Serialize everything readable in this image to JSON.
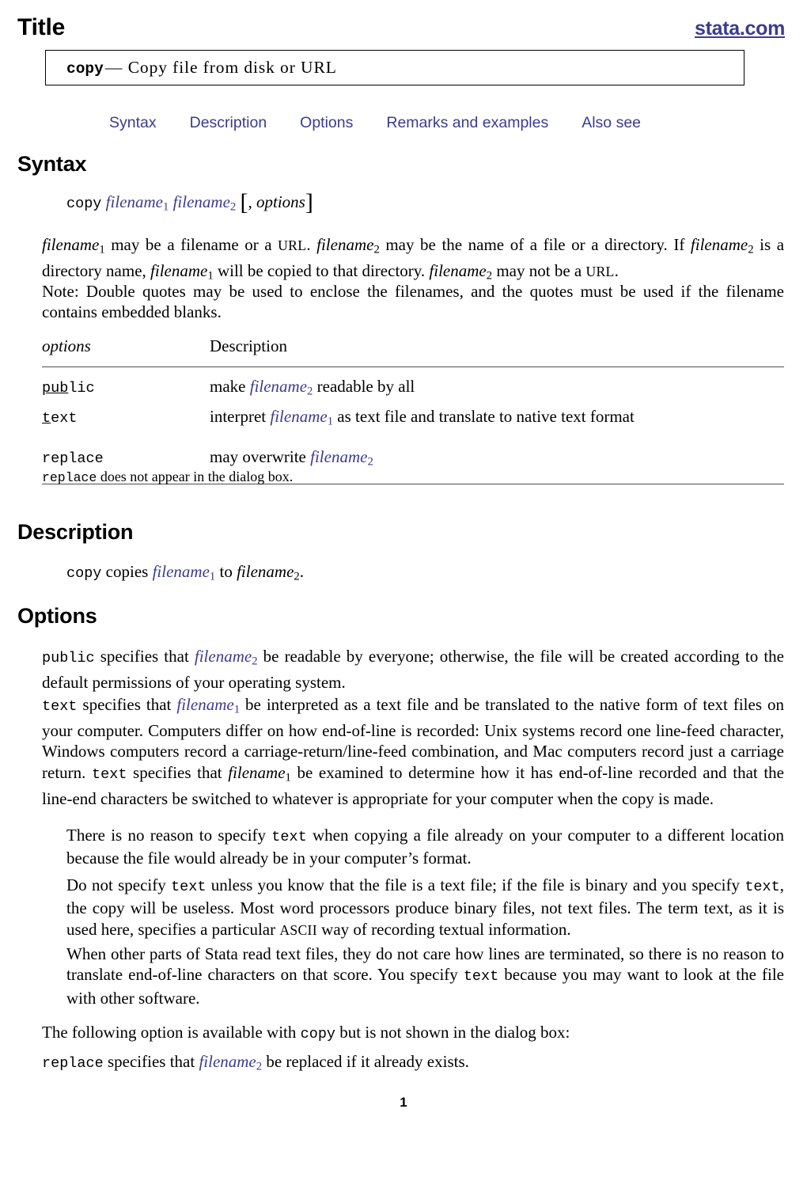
{
  "header": {
    "title": "Title",
    "site": "stata.com"
  },
  "title_box": {
    "command": "copy",
    "dash": "—",
    "description": "Copy file from disk or URL"
  },
  "nav": {
    "links": [
      {
        "label": "Syntax"
      },
      {
        "label": "Description"
      },
      {
        "label": "Options"
      },
      {
        "label": "Remarks and examples"
      },
      {
        "label": "Also see"
      }
    ]
  },
  "sections": {
    "syntax": {
      "heading": "Syntax",
      "command": "copy",
      "arg1": "filename",
      "arg1_sub": "1",
      "arg2": "filename",
      "arg2_sub": "2",
      "bracket_open": "[",
      "comma": ",",
      "options_word": "options",
      "bracket_close": "]",
      "para1_a": "filename",
      "para1_a_sub": "1",
      "para1_b": " may be a filename or a ",
      "para1_url1": "URL",
      "para1_c": ". ",
      "para1_d": "filename",
      "para1_d_sub": "2",
      "para1_e": " may be the name of a file or a directory. If ",
      "para1_f": "filename",
      "para1_f_sub": "2",
      "para1_g": " is a directory name, ",
      "para1_h": "filename",
      "para1_h_sub": "1",
      "para1_i": " will be copied to that directory. ",
      "para1_j": "filename",
      "para1_j_sub": "2",
      "para1_k": " may not be a ",
      "para1_url2": "URL",
      "para1_l": ".",
      "note": "Note: Double quotes may be used to enclose the filenames, and the quotes must be used if the filename contains embedded blanks."
    },
    "options_table": {
      "header_options": "options",
      "header_description": "Description",
      "rows": [
        {
          "option_abbrev": "pub",
          "option_rest": "lic",
          "desc_pre": "make ",
          "desc_link": "filename",
          "desc_link_sub": "2",
          "desc_post": " readable by all"
        },
        {
          "option_abbrev": "t",
          "option_rest": "ext",
          "desc_pre": "interpret ",
          "desc_link": "filename",
          "desc_link_sub": "1",
          "desc_post": " as text file and translate to native text format"
        },
        {
          "option_abbrev": "",
          "option_rest": "replace",
          "desc_pre": "may overwrite ",
          "desc_link": "filename",
          "desc_link_sub": "2",
          "desc_post": ""
        }
      ],
      "note_mono": "replace",
      "note_rest": " does not appear in the dialog box."
    },
    "description": {
      "heading": "Description",
      "cmd": "copy",
      "text_a": " copies ",
      "link1": "filename",
      "link1_sub": "1",
      "text_b": " to ",
      "plain1": "filename",
      "plain1_sub": "2",
      "text_c": "."
    },
    "options": {
      "heading": "Options",
      "public": {
        "cmd": "public",
        "a": " specifies that ",
        "link": "filename",
        "link_sub": "2",
        "b": " be readable by everyone; otherwise, the file will be created according to the default permissions of your operating system."
      },
      "text": {
        "cmd": "text",
        "a": " specifies that ",
        "link": "filename",
        "link_sub": "1",
        "b": " be interpreted as a text file and be translated to the native form of text files on your computer. Computers differ on how end-of-line is recorded: Unix systems record one line-feed character, Windows computers record a carriage-return/line-feed combination, and Mac computers record just a carriage return. ",
        "cmd2": "text",
        "c": " specifies that ",
        "plain": "filename",
        "plain_sub": "1",
        "d": " be examined to determine how it has end-of-line recorded and that the line-end characters be switched to whatever is appropriate for your computer when the copy is made."
      },
      "para_noreason": {
        "a": "There is no reason to specify ",
        "cmd": "text",
        "b": " when copying a file already on your computer to a different location because the file would already be in your computer’s format."
      },
      "para_donot": {
        "a": "Do not specify ",
        "cmd1": "text",
        "b": " unless you know that the file is a text file; if the file is binary and you specify ",
        "cmd2": "text",
        "c": ", the copy will be useless. Most word processors produce binary files, not text files. The term text, as it is used here, specifies a particular ",
        "ascii": "ASCII",
        "d": " way of recording textual information."
      },
      "para_when": {
        "a": "When other parts of Stata read text files, they do not care how lines are terminated, so there is no reason to translate end-of-line characters on that score. You specify ",
        "cmd": "text",
        "b": " because you may want to look at the file with other software."
      },
      "para_following": {
        "a": "The following option is available with ",
        "cmd": "copy",
        "b": " but is not shown in the dialog box:"
      },
      "replace": {
        "cmd": "replace",
        "a": " specifies that ",
        "link": "filename",
        "link_sub": "2",
        "b": " be replaced if it already exists."
      }
    }
  },
  "footer": {
    "page_number": "1"
  },
  "colors": {
    "link_blue": "#3b3b8f",
    "rule_gray": "#4d4d4d",
    "text_black": "#000000"
  }
}
